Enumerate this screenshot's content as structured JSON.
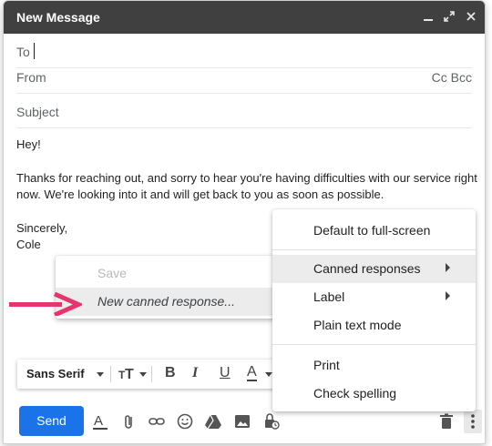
{
  "window": {
    "title": "New Message",
    "controls": [
      "minimize-icon",
      "expand-icon",
      "close-icon"
    ]
  },
  "fields": {
    "to_label": "To",
    "from_label": "From",
    "cc_bcc": "Cc Bcc",
    "subject_label": "Subject"
  },
  "body": {
    "greeting": "Hey!",
    "paragraph_line1": "Thanks for reaching out, and sorry to hear you're having difficulties with our service right",
    "paragraph_line2": "now. We're looking into it and will get back to you as soon as possible.",
    "signoff": "Sincerely,",
    "name": "Cole"
  },
  "more_options_menu": {
    "items": [
      {
        "label": "Default to full-screen"
      },
      {
        "label": "Canned responses",
        "submenu": true,
        "highlighted": true
      },
      {
        "label": "Label",
        "submenu": true
      },
      {
        "label": "Plain text mode"
      },
      {
        "label": "Print"
      },
      {
        "label": "Check spelling"
      }
    ]
  },
  "canned_submenu": {
    "items": [
      {
        "label": "Save",
        "disabled": true
      },
      {
        "label": "New canned response...",
        "highlighted": true
      }
    ]
  },
  "format_bar": {
    "font": "Sans Serif",
    "buttons": [
      "font-size-icon",
      "bold-icon",
      "italic-icon",
      "underline-icon",
      "text-color-icon"
    ]
  },
  "actions": {
    "send_label": "Send",
    "icons": [
      "formatting-icon",
      "attach-icon",
      "link-icon",
      "emoji-icon",
      "drive-icon",
      "photo-icon",
      "confidential-icon",
      "trash-icon",
      "more-options-icon"
    ]
  },
  "colors": {
    "titlebar": "#404040",
    "send": "#1a73e8",
    "annotation_arrow": "#e8336d"
  }
}
